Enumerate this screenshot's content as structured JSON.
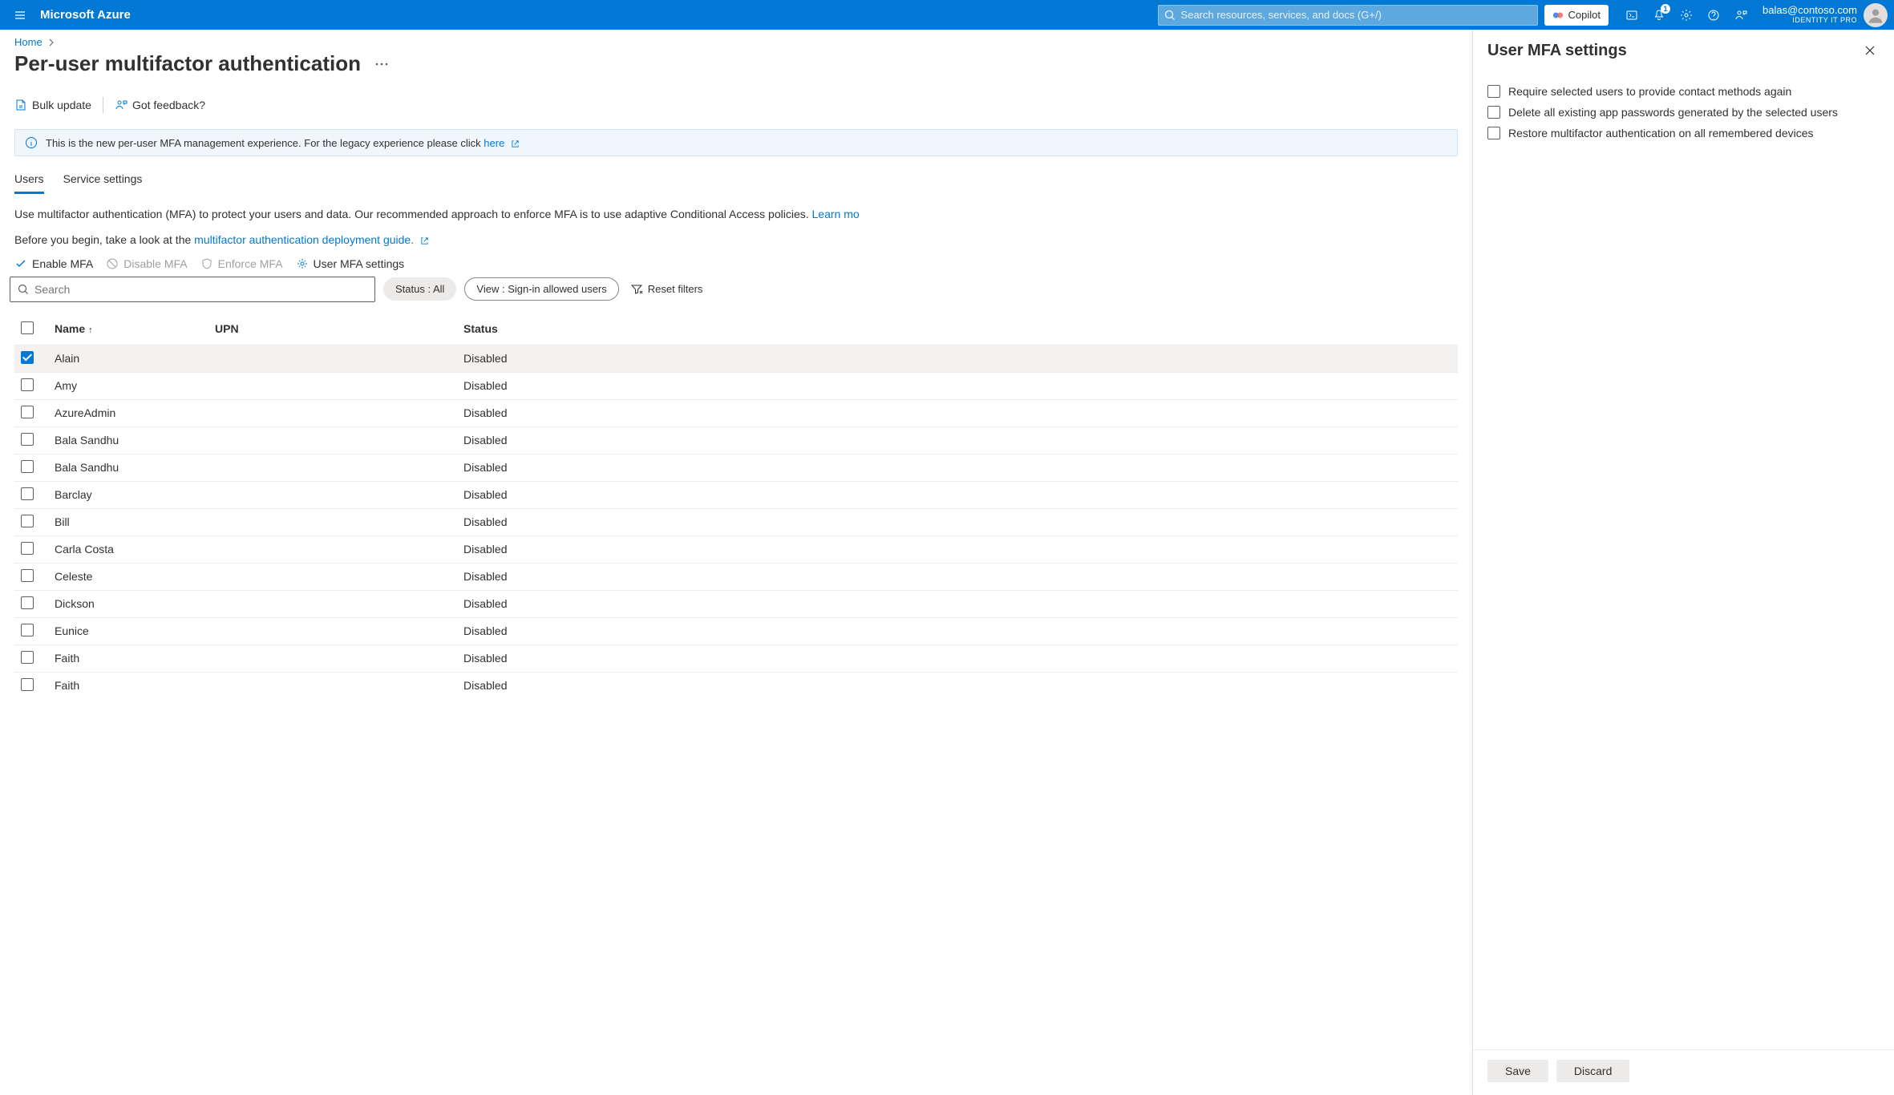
{
  "header": {
    "brand": "Microsoft Azure",
    "search_placeholder": "Search resources, services, and docs (G+/)",
    "copilot_label": "Copilot",
    "notification_count": "1",
    "account": {
      "email": "balas@contoso.com",
      "tenant": "IDENTITY IT PRO"
    }
  },
  "breadcrumb": {
    "home": "Home"
  },
  "page": {
    "title": "Per-user multifactor authentication"
  },
  "toolbar": {
    "bulk_update": "Bulk update",
    "feedback": "Got feedback?"
  },
  "banner": {
    "text_before": "This is the new per-user MFA management experience. For the legacy experience please click ",
    "link": "here"
  },
  "tabs": {
    "users": "Users",
    "service_settings": "Service settings"
  },
  "description": {
    "line1_before": "Use multifactor authentication (MFA) to protect your users and data. Our recommended approach to enforce MFA is to use adaptive Conditional Access policies. ",
    "line1_link": "Learn mo",
    "line2_before": "Before you begin, take a look at the ",
    "line2_link": "multifactor authentication deployment guide."
  },
  "actions": {
    "enable": "Enable MFA",
    "disable": "Disable MFA",
    "enforce": "Enforce MFA",
    "settings": "User MFA settings"
  },
  "filters": {
    "search_placeholder": "Search",
    "status_pill": "Status : All",
    "view_pill": "View : Sign-in allowed users",
    "reset": "Reset filters"
  },
  "table": {
    "headers": {
      "name": "Name",
      "upn": "UPN",
      "status": "Status"
    },
    "rows": [
      {
        "name": "Alain",
        "upn": "",
        "status": "Disabled",
        "selected": true
      },
      {
        "name": "Amy",
        "upn": "",
        "status": "Disabled",
        "selected": false
      },
      {
        "name": "AzureAdmin",
        "upn": "",
        "status": "Disabled",
        "selected": false
      },
      {
        "name": "Bala Sandhu",
        "upn": "",
        "status": "Disabled",
        "selected": false
      },
      {
        "name": "Bala Sandhu",
        "upn": "",
        "status": "Disabled",
        "selected": false
      },
      {
        "name": "Barclay",
        "upn": "",
        "status": "Disabled",
        "selected": false
      },
      {
        "name": "Bill",
        "upn": "",
        "status": "Disabled",
        "selected": false
      },
      {
        "name": "Carla Costa",
        "upn": "",
        "status": "Disabled",
        "selected": false
      },
      {
        "name": "Celeste",
        "upn": "",
        "status": "Disabled",
        "selected": false
      },
      {
        "name": "Dickson",
        "upn": "",
        "status": "Disabled",
        "selected": false
      },
      {
        "name": "Eunice",
        "upn": "",
        "status": "Disabled",
        "selected": false
      },
      {
        "name": "Faith",
        "upn": "",
        "status": "Disabled",
        "selected": false
      },
      {
        "name": "Faith",
        "upn": "",
        "status": "Disabled",
        "selected": false
      }
    ]
  },
  "panel": {
    "title": "User MFA settings",
    "options": {
      "require_contact": "Require selected users to provide contact methods again",
      "delete_app_pw": "Delete all existing app passwords generated by the selected users",
      "restore_mfa": "Restore multifactor authentication on all remembered devices"
    },
    "buttons": {
      "save": "Save",
      "discard": "Discard"
    }
  }
}
